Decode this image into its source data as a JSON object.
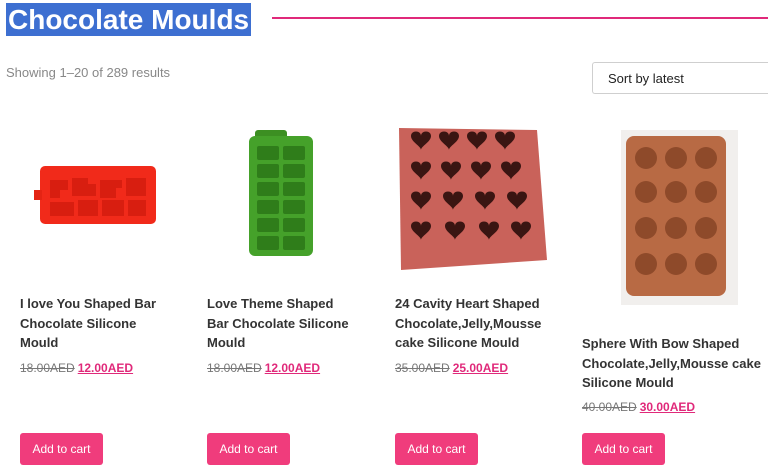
{
  "page": {
    "title": "Chocolate Moulds"
  },
  "results": {
    "count_text": "Showing 1–20 of 289 results"
  },
  "sort": {
    "selected": "Sort by latest"
  },
  "products": [
    {
      "name": "I love You Shaped Bar Chocolate Silicone Mould",
      "old_price": "18.00AED",
      "new_price": "12.00AED",
      "button": "Add to cart",
      "image": "red-love-bar-mould"
    },
    {
      "name": "Love Theme Shaped Bar Chocolate Silicone Mould",
      "old_price": "18.00AED",
      "new_price": "12.00AED",
      "button": "Add to cart",
      "image": "green-love-theme-mould"
    },
    {
      "name": "24 Cavity Heart Shaped Chocolate,Jelly,Mousse cake Silicone Mould",
      "old_price": "35.00AED",
      "new_price": "25.00AED",
      "button": "Add to cart",
      "image": "heart-cavity-mould"
    },
    {
      "name": "Sphere With Bow Shaped Chocolate,Jelly,Mousse cake Silicone Mould",
      "old_price": "40.00AED",
      "new_price": "30.00AED",
      "button": "Add to cart",
      "image": "sphere-bow-mould"
    }
  ],
  "colors": {
    "accent": "#e0297a",
    "button": "#f03c7c",
    "title_highlight": "#3d6fd1"
  }
}
